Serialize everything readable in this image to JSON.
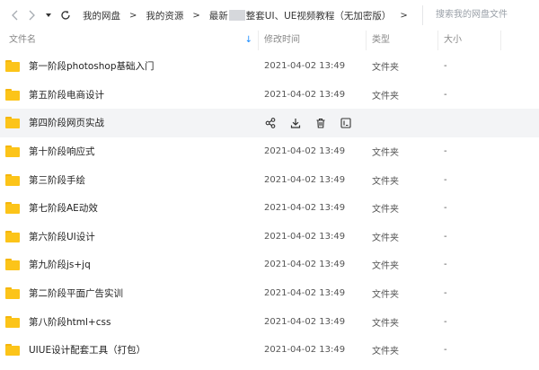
{
  "toolbar": {
    "breadcrumbs": [
      "我的网盘",
      "我的资源"
    ],
    "current_prefix": "最新",
    "current_suffix": "整套UI、UE视频教程（无加密版）",
    "search_placeholder": "搜索我的网盘文件"
  },
  "columns": {
    "name": "文件名",
    "mtime": "修改时间",
    "type": "类型",
    "size": "大小"
  },
  "rows": [
    {
      "name": "第一阶段photoshop基础入门",
      "mtime": "2021-04-02 13:49",
      "type": "文件夹",
      "size": "-"
    },
    {
      "name": "第五阶段电商设计",
      "mtime": "2021-04-02 13:49",
      "type": "文件夹",
      "size": "-"
    },
    {
      "name": "第四阶段网页实战",
      "mtime": "",
      "type": "",
      "size": ""
    },
    {
      "name": "第十阶段响应式",
      "mtime": "2021-04-02 13:49",
      "type": "文件夹",
      "size": "-"
    },
    {
      "name": "第三阶段手绘",
      "mtime": "2021-04-02 13:49",
      "type": "文件夹",
      "size": "-"
    },
    {
      "name": "第七阶段AE动效",
      "mtime": "2021-04-02 13:49",
      "type": "文件夹",
      "size": "-"
    },
    {
      "name": "第六阶段UI设计",
      "mtime": "2021-04-02 13:49",
      "type": "文件夹",
      "size": "-"
    },
    {
      "name": "第九阶段js+jq",
      "mtime": "2021-04-02 13:49",
      "type": "文件夹",
      "size": "-"
    },
    {
      "name": "第二阶段平面广告实训",
      "mtime": "2021-04-02 13:49",
      "type": "文件夹",
      "size": "-"
    },
    {
      "name": "第八阶段html+css",
      "mtime": "2021-04-02 13:49",
      "type": "文件夹",
      "size": "-"
    },
    {
      "name": "UIUE设计配套工具（打包）",
      "mtime": "2021-04-02 13:49",
      "type": "文件夹",
      "size": "-"
    }
  ],
  "icons": {
    "back": "chevron-left-icon",
    "dropdown": "caret-down-icon",
    "refresh": "refresh-icon",
    "sort": "arrow-down-icon",
    "folder": "folder-icon",
    "share": "share-icon",
    "download": "download-icon",
    "delete": "trash-icon",
    "more": "rename-icon"
  },
  "colors": {
    "folder": "#fcc419",
    "accent": "#1a8cff",
    "hover_row": "#f3f4f6"
  }
}
